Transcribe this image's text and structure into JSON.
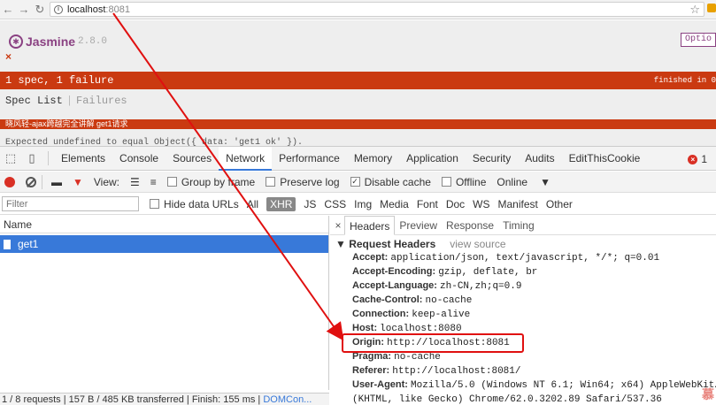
{
  "browser": {
    "url_host": "localhost",
    "url_port": ":8081"
  },
  "jasmine": {
    "name": "Jasmine",
    "version": "2.8.0",
    "options_label": "Optio",
    "close_glyph": "×",
    "summary": "1 spec, 1 failure",
    "finished": "finished in 0",
    "spec_list": "Spec List",
    "separator": "|",
    "failures": "Failures",
    "spec_title": "晓风轻-ajax跨越完全讲解 get1请求",
    "expected": "Expected undefined to equal Object({ data: 'get1 ok' })."
  },
  "devtools": {
    "tabs": [
      "Elements",
      "Console",
      "Sources",
      "Network",
      "Performance",
      "Memory",
      "Application",
      "Security",
      "Audits",
      "EditThisCookie"
    ],
    "error_count": "1",
    "toolbar": {
      "view": "View:",
      "group_by_frame": "Group by frame",
      "preserve_log": "Preserve log",
      "disable_cache": "Disable cache",
      "offline": "Offline",
      "online": "Online"
    },
    "filter": {
      "placeholder": "Filter",
      "hide_data_urls": "Hide data URLs",
      "types": [
        "All",
        "XHR",
        "JS",
        "CSS",
        "Img",
        "Media",
        "Font",
        "Doc",
        "WS",
        "Manifest",
        "Other"
      ]
    },
    "requests": {
      "column": "Name",
      "rows": [
        "get1"
      ]
    },
    "status": {
      "text": "1 / 8 requests | 157 B / 485 KB transferred | Finish: 155 ms | ",
      "link": "DOMCon..."
    },
    "headers_pane": {
      "close": "×",
      "tabs": [
        "Headers",
        "Preview",
        "Response",
        "Timing"
      ],
      "section": "▼ Request Headers",
      "view_source": "view source",
      "lines": [
        {
          "key": "Accept:",
          "value": "application/json, text/javascript, */*; q=0.01"
        },
        {
          "key": "Accept-Encoding:",
          "value": "gzip, deflate, br"
        },
        {
          "key": "Accept-Language:",
          "value": "zh-CN,zh;q=0.9"
        },
        {
          "key": "Cache-Control:",
          "value": "no-cache"
        },
        {
          "key": "Connection:",
          "value": "keep-alive"
        },
        {
          "key": "Host:",
          "value": "localhost:8080"
        },
        {
          "key": "Origin:",
          "value": "http://localhost:8081"
        },
        {
          "key": "Pragma:",
          "value": "no-cache"
        },
        {
          "key": "Referer:",
          "value": "http://localhost:8081/"
        },
        {
          "key": "User-Agent:",
          "value": "Mozilla/5.0 (Windows NT 6.1; Win64; x64) AppleWebKit/537.36"
        },
        {
          "key": "",
          "value": "(KHTML, like Gecko) Chrome/62.0.3202.89 Safari/537.36"
        }
      ]
    }
  },
  "overlay": {
    "watermark": "慕"
  },
  "colors": {
    "accent": "#ca3a11",
    "jasmine_purple": "#8a4182",
    "devtools_blue": "#3879d9",
    "annotation_red": "#e01010"
  }
}
